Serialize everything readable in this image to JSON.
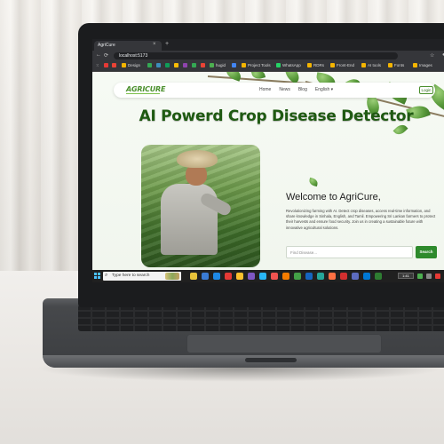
{
  "browser": {
    "tab_title": "AgriCure",
    "tab_close": "×",
    "new_tab": "+",
    "url": "localhost:5173",
    "nav_icons": [
      "back-icon",
      "reload-icon"
    ],
    "bookmarks": [
      {
        "label": "Design",
        "color": "#f4b400"
      },
      {
        "label": "hugid",
        "color": "#4caf50"
      },
      {
        "label": "Project Tools",
        "color": "#f4b400"
      },
      {
        "label": "WhatsApp",
        "color": "#25d366"
      },
      {
        "label": "RDRs",
        "color": "#f4b400"
      },
      {
        "label": "Front-End",
        "color": "#f4b400"
      },
      {
        "label": "AI tools",
        "color": "#f4b400"
      },
      {
        "label": "Fonts",
        "color": "#f4b400"
      },
      {
        "label": "Images",
        "color": "#f4b400"
      }
    ]
  },
  "site": {
    "logo": "AGRICURE",
    "nav": {
      "home": "Home",
      "news": "News",
      "blog": "Blog",
      "language": "English ▾",
      "login": "Login"
    },
    "hero_title": "AI Powerd Crop Disease Detector",
    "welcome": "Welcome to AgriCure,",
    "description": "Revolutionizing farming with AI. Detect crop diseases, access real-time information, and share knowledge in Sinhala, English, and Tamil. Empowering Sri Lankan farmers to protect their harvests and ensure food security. Join us in creating a sustainable future with innovative agricultural solutions.",
    "search_placeholder": "Find Disease...",
    "search_button": "Search"
  },
  "taskbar": {
    "search_text": "Type here to search",
    "time": "1:41",
    "apps": [
      "#e8c33a",
      "#3a7bd5",
      "#1e88e5",
      "#e53935",
      "#fbc02d",
      "#7e57c2",
      "#29b6f6",
      "#ef5350",
      "#f57c00",
      "#43a047",
      "#1565c0",
      "#26a69a",
      "#ff7043",
      "#d32f2f",
      "#5c6bc0",
      "#0078d4",
      "#2e7d32"
    ]
  },
  "colors": {
    "brand_green": "#4a8f2c",
    "title_green": "#1f5a12",
    "search_button": "#2e8a2c"
  }
}
